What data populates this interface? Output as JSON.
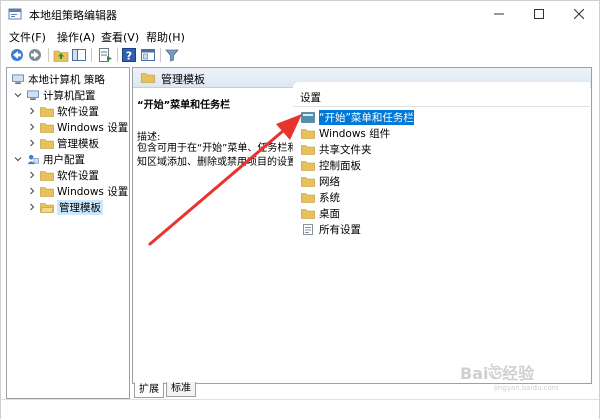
{
  "window": {
    "title": "本地组策略编辑器",
    "minimize_label": "—",
    "maximize_label": "☐",
    "close_label": "✕"
  },
  "menu": {
    "items": [
      {
        "label": "文件(F)"
      },
      {
        "label": "操作(A)"
      },
      {
        "label": "查看(V)"
      },
      {
        "label": "帮助(H)"
      }
    ]
  },
  "toolbar": {
    "icons": [
      "back-arrow-icon",
      "forward-arrow-icon",
      "up-folder-icon",
      "show-tree-icon",
      "export-list-icon",
      "help-icon",
      "properties-icon",
      "filter-icon"
    ]
  },
  "tree": {
    "root": "本地计算机 策略",
    "computer_config": "计算机配置",
    "computer_children": [
      "软件设置",
      "Windows 设置",
      "管理模板"
    ],
    "user_config": "用户配置",
    "user_children": [
      "软件设置",
      "Windows 设置",
      "管理模板"
    ]
  },
  "right_header": {
    "title": "管理模板"
  },
  "description": {
    "title": "“开始”菜单和任务栏",
    "label": "描述:",
    "body": "包含可用于在“开始”菜单、任务栏和通知区域添加、删除或禁用项目的设置。"
  },
  "settings": {
    "header": "设置",
    "rows": [
      {
        "label": "“开始”菜单和任务栏",
        "selected": true
      },
      {
        "label": "Windows 组件",
        "selected": false
      },
      {
        "label": "共享文件夹",
        "selected": false
      },
      {
        "label": "控制面板",
        "selected": false
      },
      {
        "label": "网络",
        "selected": false
      },
      {
        "label": "系统",
        "selected": false
      },
      {
        "label": "桌面",
        "selected": false
      },
      {
        "label": "所有设置",
        "selected": false
      }
    ]
  },
  "tabs": {
    "expanded": "扩展",
    "standard": "标准"
  },
  "watermark": {
    "text": "Baiঊ经验",
    "sub": "jingyan.baidu.com"
  },
  "colors": {
    "selection": "#0078d7",
    "folder": "#e8c15a",
    "annotation_arrow": "#e8332f"
  }
}
